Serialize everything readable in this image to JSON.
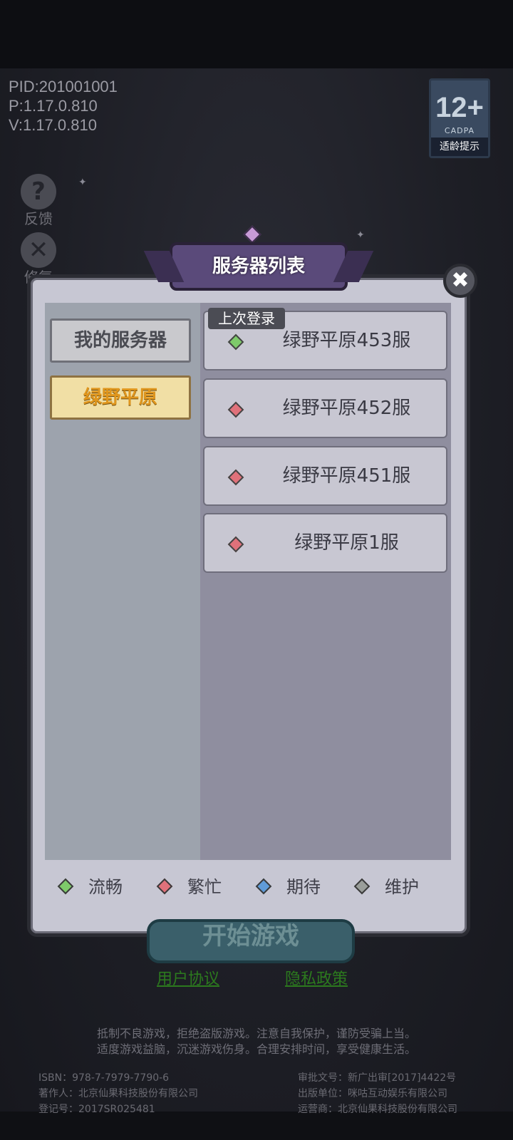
{
  "info": {
    "pid": "PID:201001001",
    "p": "P:1.17.0.810",
    "v": "V:1.17.0.810"
  },
  "rating": {
    "age": "12+",
    "org": "CADPA",
    "tip": "适龄提示"
  },
  "side": {
    "feedback": "反馈",
    "repair": "修复"
  },
  "dialog": {
    "title": "服务器列表"
  },
  "categories": [
    {
      "label": "我的服务器"
    },
    {
      "label": "绿野平原"
    }
  ],
  "last_login": "上次登录",
  "servers": [
    {
      "name": "绿野平原453服",
      "status_color": "#7ecb6a"
    },
    {
      "name": "绿野平原452服",
      "status_color": "#e0717a"
    },
    {
      "name": "绿野平原451服",
      "status_color": "#e0717a"
    },
    {
      "name": "绿野平原1服",
      "status_color": "#e0717a"
    }
  ],
  "legend": [
    {
      "label": "流畅",
      "color": "#7ecb6a"
    },
    {
      "label": "繁忙",
      "color": "#e0717a"
    },
    {
      "label": "期待",
      "color": "#5f9bd8"
    },
    {
      "label": "维护",
      "color": "#9a9e9a"
    }
  ],
  "start": "开始游戏",
  "links": {
    "agreement": "用户协议",
    "privacy": "隐私政策"
  },
  "notice": [
    "抵制不良游戏，拒绝盗版游戏。注意自我保护，谨防受骗上当。",
    "适度游戏益脑，沉迷游戏伤身。合理安排时间，享受健康生活。"
  ],
  "footer": {
    "isbn": "ISBN：978-7-7979-7790-6",
    "author": "著作人：北京仙果科技股份有限公司",
    "reg": "登记号：2017SR025481",
    "approval": "审批文号：新广出审[2017]4422号",
    "publisher": "出版单位：咪咕互动娱乐有限公司",
    "operator": "运营商：北京仙果科技股份有限公司"
  }
}
